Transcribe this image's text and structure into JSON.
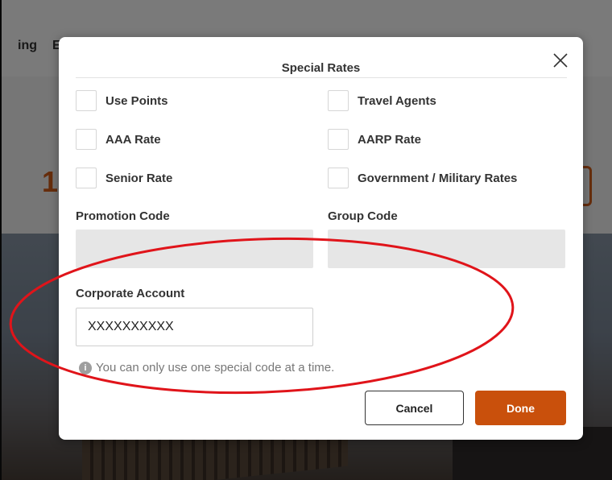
{
  "background": {
    "nav_partial_1": "ing",
    "nav_partial_2": "E",
    "price_partial": "1"
  },
  "modal": {
    "title": "Special Rates",
    "close_icon": "close-icon",
    "options": [
      {
        "label": "Use Points",
        "checked": false
      },
      {
        "label": "Travel Agents",
        "checked": false
      },
      {
        "label": "AAA Rate",
        "checked": false
      },
      {
        "label": "AARP Rate",
        "checked": false
      },
      {
        "label": "Senior Rate",
        "checked": false
      },
      {
        "label": "Government / Military Rates",
        "checked": false
      }
    ],
    "promotion_code": {
      "label": "Promotion Code",
      "value": ""
    },
    "group_code": {
      "label": "Group Code",
      "value": ""
    },
    "corporate_account": {
      "label": "Corporate Account",
      "value": "XXXXXXXXXX"
    },
    "info_text": "You can only use one special code at a time.",
    "cancel_label": "Cancel",
    "done_label": "Done"
  },
  "colors": {
    "accent": "#c9500c",
    "annotation": "#e0141a"
  }
}
